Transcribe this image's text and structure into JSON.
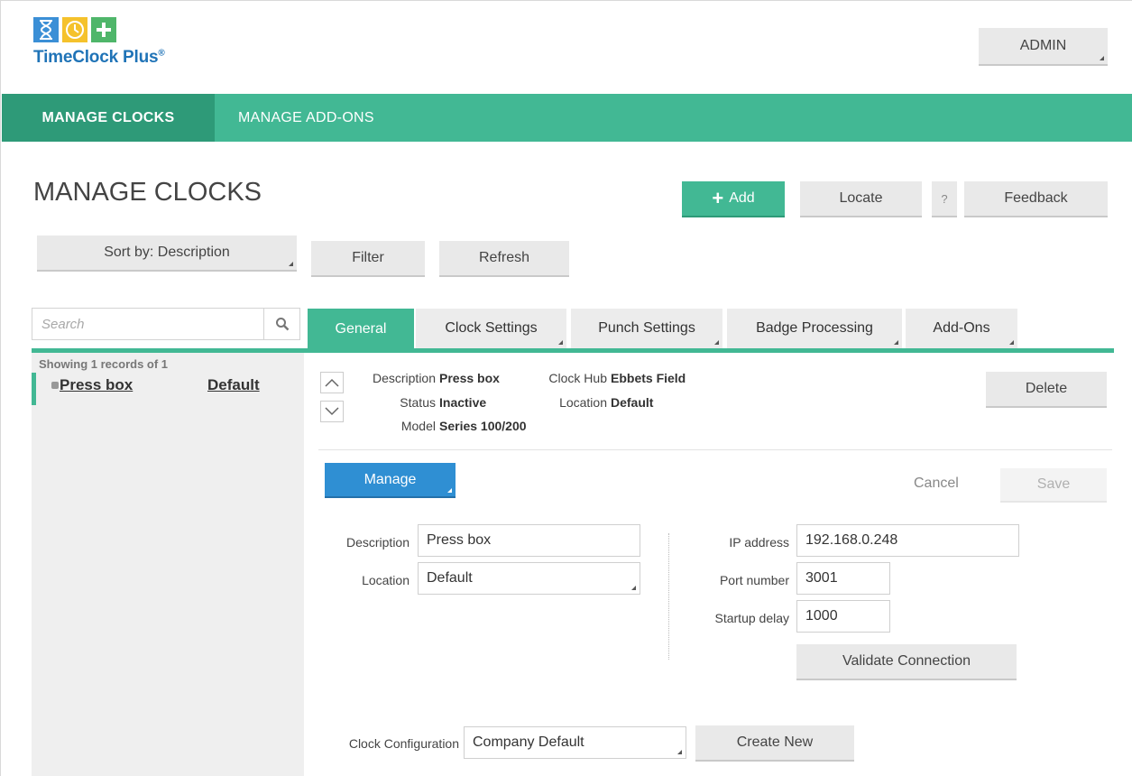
{
  "app": {
    "name": "TimeClock Plus",
    "registered": "®",
    "user_button": "ADMIN"
  },
  "nav": {
    "items": [
      {
        "label": "MANAGE  CLOCKS"
      },
      {
        "label": "MANAGE  ADD-ONS"
      }
    ]
  },
  "page": {
    "title": "MANAGE CLOCKS",
    "add_label": "Add",
    "locate_label": "Locate",
    "help_label": "?",
    "feedback_label": "Feedback",
    "sort_label": "Sort by: Description",
    "filter_label": "Filter",
    "refresh_label": "Refresh"
  },
  "search": {
    "placeholder": "Search"
  },
  "tabs": [
    {
      "label": "General"
    },
    {
      "label": "Clock Settings"
    },
    {
      "label": "Punch Settings"
    },
    {
      "label": "Badge Processing"
    },
    {
      "label": "Add-Ons"
    }
  ],
  "list": {
    "summary": "Showing 1 records of 1",
    "items": [
      {
        "name": " Press box",
        "location": "Default"
      }
    ]
  },
  "detail": {
    "description_label": "Description",
    "description_value": "Press box",
    "status_label": "Status",
    "status_value": "Inactive",
    "model_label": "Model",
    "model_value": "Series 100/200",
    "hub_label": "Clock Hub",
    "hub_value": "Ebbets Field",
    "location_label": "Location",
    "location_value": "Default",
    "delete_label": "Delete",
    "manage_label": "Manage",
    "cancel_label": "Cancel",
    "save_label": "Save"
  },
  "form": {
    "description_label": "Description",
    "description_value": "Press box",
    "location_label": "Location",
    "location_value": "Default",
    "ip_label": "IP address",
    "ip_value": "192.168.0.248",
    "port_label": "Port number",
    "port_value": "3001",
    "delay_label": "Startup delay",
    "delay_value": "1000",
    "validate_label": "Validate Connection",
    "config_label": "Clock Configuration",
    "config_value": "Company Default",
    "create_label": "Create New"
  },
  "colors": {
    "brand_green": "#42b894",
    "brand_green_dark": "#2e9a78",
    "manage_blue": "#2f8fd3",
    "logo_blue": "#1f73b7"
  }
}
